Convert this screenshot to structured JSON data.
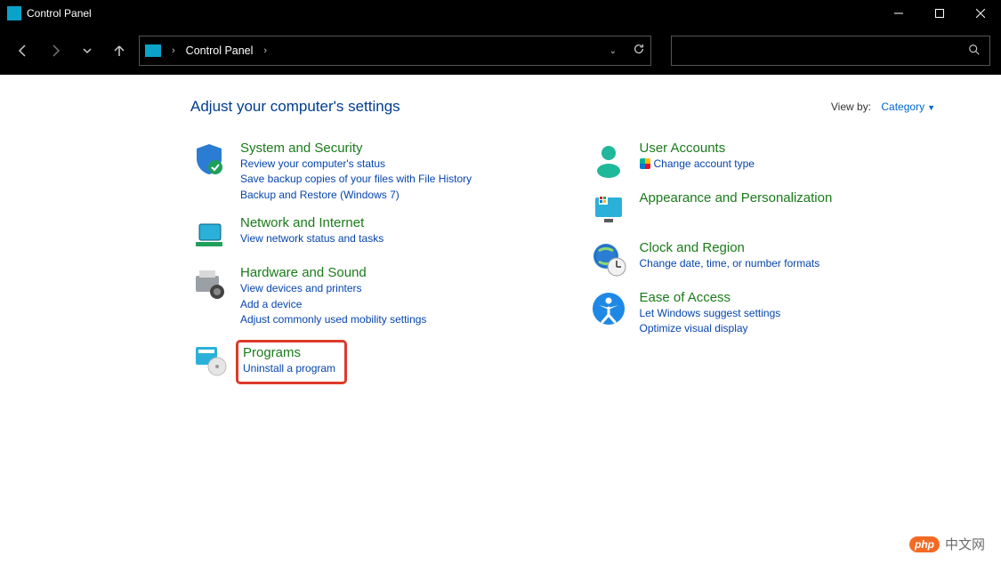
{
  "titlebar": {
    "title": "Control Panel"
  },
  "addressbar": {
    "path": "Control Panel"
  },
  "header": {
    "heading": "Adjust your computer's settings",
    "viewby_label": "View by:",
    "viewby_value": "Category"
  },
  "left_categories": [
    {
      "id": "system-security",
      "title": "System and Security",
      "icon": "shield-check-icon",
      "links": [
        {
          "text": "Review your computer's status",
          "shield": false
        },
        {
          "text": "Save backup copies of your files with File History",
          "shield": false
        },
        {
          "text": "Backup and Restore (Windows 7)",
          "shield": false
        }
      ]
    },
    {
      "id": "network-internet",
      "title": "Network and Internet",
      "icon": "globe-network-icon",
      "links": [
        {
          "text": "View network status and tasks",
          "shield": false
        }
      ]
    },
    {
      "id": "hardware-sound",
      "title": "Hardware and Sound",
      "icon": "printer-camera-icon",
      "links": [
        {
          "text": "View devices and printers",
          "shield": false
        },
        {
          "text": "Add a device",
          "shield": false
        },
        {
          "text": "Adjust commonly used mobility settings",
          "shield": false
        }
      ]
    },
    {
      "id": "programs",
      "title": "Programs",
      "icon": "programs-disc-icon",
      "highlighted": true,
      "links": [
        {
          "text": "Uninstall a program",
          "shield": false
        }
      ]
    }
  ],
  "right_categories": [
    {
      "id": "user-accounts",
      "title": "User Accounts",
      "icon": "user-icon",
      "links": [
        {
          "text": "Change account type",
          "shield": true
        }
      ]
    },
    {
      "id": "appearance",
      "title": "Appearance and Personalization",
      "icon": "monitor-icon",
      "links": []
    },
    {
      "id": "clock-region",
      "title": "Clock and Region",
      "icon": "clock-globe-icon",
      "links": [
        {
          "text": "Change date, time, or number formats",
          "shield": false
        }
      ]
    },
    {
      "id": "ease-of-access",
      "title": "Ease of Access",
      "icon": "accessibility-icon",
      "links": [
        {
          "text": "Let Windows suggest settings",
          "shield": false
        },
        {
          "text": "Optimize visual display",
          "shield": false
        }
      ]
    }
  ],
  "watermark": {
    "logo": "php",
    "text": "中文网"
  }
}
